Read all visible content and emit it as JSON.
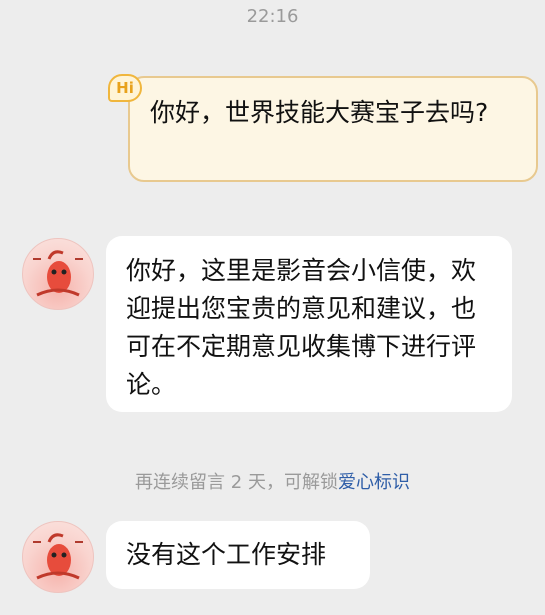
{
  "status": {
    "timestamp": "22:16"
  },
  "messages": [
    {
      "direction": "outgoing",
      "badge": "Hi",
      "text": "你好，世界技能大赛宝子去吗?"
    },
    {
      "direction": "incoming",
      "avatar": "shrimp-avatar",
      "text": "你好，这里是影音会小信使，欢迎提出您宝贵的意见和建议，也可在不定期意见收集博下进行评论。"
    },
    {
      "direction": "incoming",
      "avatar": "shrimp-avatar",
      "text": "没有这个工作安排"
    }
  ],
  "notice": {
    "prefix": "再连续留言 2 天，可解锁",
    "link": "爱心标识"
  },
  "colors": {
    "background": "#ededed",
    "outgoing_bubble": "#fdf6e4",
    "outgoing_border": "#e8c98f",
    "incoming_bubble": "#ffffff",
    "link": "#2f5ea8"
  }
}
